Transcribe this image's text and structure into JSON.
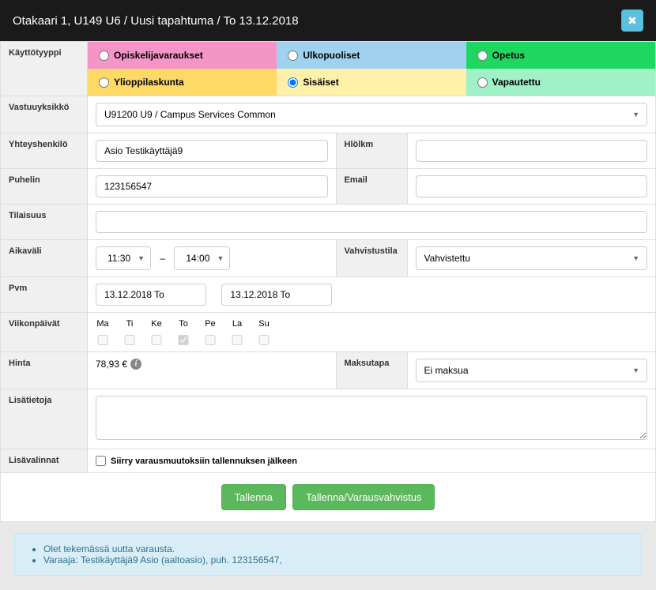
{
  "header": {
    "title": "Otakaari 1, U149 U6 / Uusi tapahtuma / To 13.12.2018",
    "close": "✖"
  },
  "labels": {
    "usage_type": "Käyttötyyppi",
    "department": "Vastuuyksikkö",
    "contact": "Yhteyshenkilö",
    "hlolkm": "Hlölkm",
    "phone": "Puhelin",
    "email": "Email",
    "event": "Tilaisuus",
    "timespan": "Aikaväli",
    "confirm_status": "Vahvistustila",
    "date": "Pvm",
    "weekdays": "Viikonpäivät",
    "price": "Hinta",
    "payment_method": "Maksutapa",
    "notes": "Lisätietoja",
    "extra": "Lisävalinnat"
  },
  "usage_types": {
    "student": "Opiskelijavaraukset",
    "external": "Ulkopuoliset",
    "teaching": "Opetus",
    "union": "Ylioppilaskunta",
    "internal": "Sisäiset",
    "released": "Vapautettu"
  },
  "department": {
    "value": "U91200 U9 / Campus Services Common"
  },
  "contact": {
    "value": "Asio Testikäyttäjä9"
  },
  "phone": {
    "value": "123156547"
  },
  "time": {
    "start": "11:30",
    "end": "14:00",
    "sep": "–"
  },
  "confirm_status": {
    "value": "Vahvistettu"
  },
  "date": {
    "start": "13.12.2018 To",
    "end": "13.12.2018 To"
  },
  "weekdays": {
    "labels": [
      "Ma",
      "Ti",
      "Ke",
      "To",
      "Pe",
      "La",
      "Su"
    ]
  },
  "price": {
    "text": "78,93 €"
  },
  "payment_method": {
    "value": "Ei maksua"
  },
  "extra": {
    "checkbox_label": "Siirry varausmuutoksiin tallennuksen jälkeen"
  },
  "buttons": {
    "save": "Tallenna",
    "save_confirm": "Tallenna/Varausvahvistus"
  },
  "info": {
    "line1": "Olet tekemässä uutta varausta.",
    "line2": "Varaaja: Testikäyttäjä9 Asio (aaltoasio), puh. 123156547,"
  }
}
